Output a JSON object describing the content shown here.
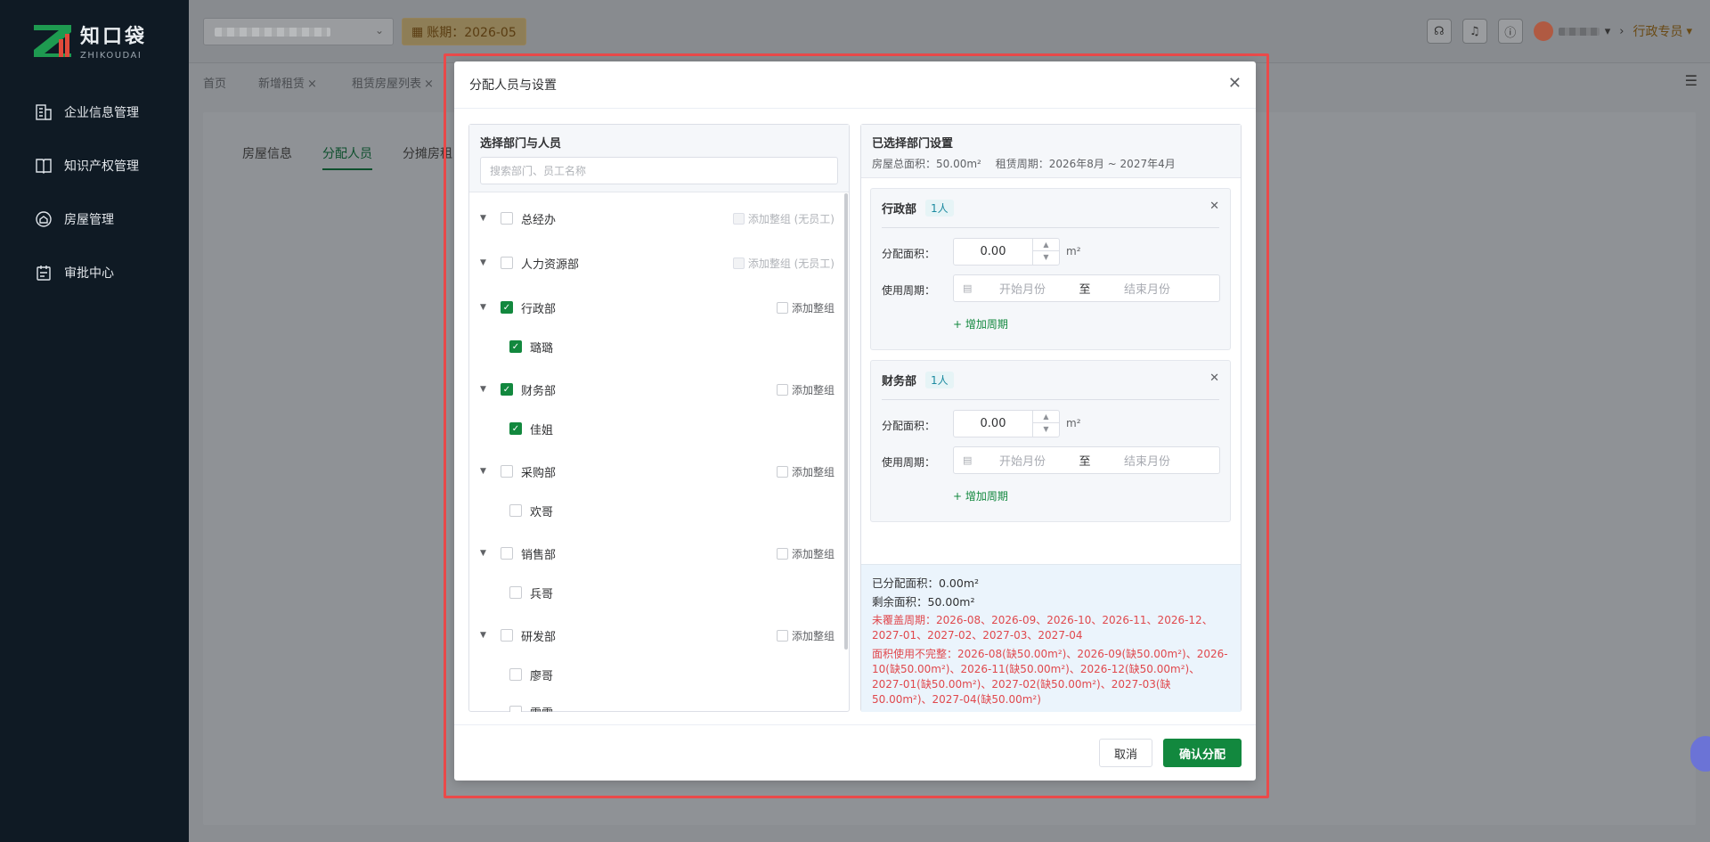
{
  "logo": {
    "cn": "知口袋",
    "en": "ZHIKOUDAI"
  },
  "sidebar": {
    "items": [
      {
        "label": "企业信息管理",
        "icon": "building-icon"
      },
      {
        "label": "知识产权管理",
        "icon": "book-icon"
      },
      {
        "label": "房屋管理",
        "icon": "house-icon"
      },
      {
        "label": "审批中心",
        "icon": "clipboard-icon"
      }
    ]
  },
  "header": {
    "period_label": "账期：2026-05",
    "role": "行政专员"
  },
  "tabs": [
    {
      "label": "首页"
    },
    {
      "label": "新增租赁"
    },
    {
      "label": "租赁房屋列表"
    }
  ],
  "subtabs": [
    {
      "label": "房屋信息"
    },
    {
      "label": "分配人员"
    },
    {
      "label": "分摊房租"
    }
  ],
  "dialog": {
    "title": "分配人员与设置",
    "left": {
      "title": "选择部门与人员",
      "search_placeholder": "搜索部门、员工名称",
      "departments": [
        {
          "name": "总经办",
          "checked": false,
          "group_label": "添加整组 (无员工)",
          "group_disabled": true,
          "employees": []
        },
        {
          "name": "人力资源部",
          "checked": false,
          "group_label": "添加整组 (无员工)",
          "group_disabled": true,
          "employees": []
        },
        {
          "name": "行政部",
          "checked": true,
          "group_label": "添加整组",
          "group_disabled": false,
          "employees": [
            {
              "name": "璐璐",
              "checked": true
            }
          ]
        },
        {
          "name": "财务部",
          "checked": true,
          "group_label": "添加整组",
          "group_disabled": false,
          "employees": [
            {
              "name": "佳姐",
              "checked": true
            }
          ]
        },
        {
          "name": "采购部",
          "checked": false,
          "group_label": "添加整组",
          "group_disabled": false,
          "employees": [
            {
              "name": "欢哥",
              "checked": false
            }
          ]
        },
        {
          "name": "销售部",
          "checked": false,
          "group_label": "添加整组",
          "group_disabled": false,
          "employees": [
            {
              "name": "兵哥",
              "checked": false
            }
          ]
        },
        {
          "name": "研发部",
          "checked": false,
          "group_label": "添加整组",
          "group_disabled": false,
          "employees": [
            {
              "name": "廖哥",
              "checked": false
            },
            {
              "name": "雯雯",
              "checked": false
            }
          ]
        }
      ]
    },
    "right": {
      "title": "已选择部门设置",
      "total_area": "房屋总面积：50.00m²",
      "lease_period": "租赁周期：2026年8月 ~ 2027年4月",
      "cards": [
        {
          "dept": "行政部",
          "count": "1人",
          "area_label": "分配面积：",
          "area_value": "0.00",
          "unit": "m²",
          "period_label": "使用周期：",
          "start_placeholder": "开始月份",
          "to": "至",
          "end_placeholder": "结束月份",
          "add_period": "+ 增加周期"
        },
        {
          "dept": "财务部",
          "count": "1人",
          "area_label": "分配面积：",
          "area_value": "0.00",
          "unit": "m²",
          "period_label": "使用周期：",
          "start_placeholder": "开始月份",
          "to": "至",
          "end_placeholder": "结束月份",
          "add_period": "+ 增加周期"
        }
      ],
      "summary": {
        "allocated": "已分配面积：0.00m²",
        "remaining": "剩余面积：50.00m²",
        "uncovered": "未覆盖周期：2026-08、2026-09、2026-10、2026-11、2026-12、2027-01、2027-02、2027-03、2027-04",
        "incomplete": "面积使用不完整：2026-08(缺50.00m²)、2026-09(缺50.00m²)、2026-10(缺50.00m²)、2026-11(缺50.00m²)、2026-12(缺50.00m²)、2027-01(缺50.00m²)、2027-02(缺50.00m²)、2027-03(缺50.00m²)、2027-04(缺50.00m²)"
      }
    },
    "cancel_label": "取消",
    "confirm_label": "确认分配"
  },
  "colors": {
    "primary": "#12883e",
    "warning": "#e0484d",
    "highlight": "#ea4a4a",
    "sidebar_bg": "#0f1a24"
  }
}
